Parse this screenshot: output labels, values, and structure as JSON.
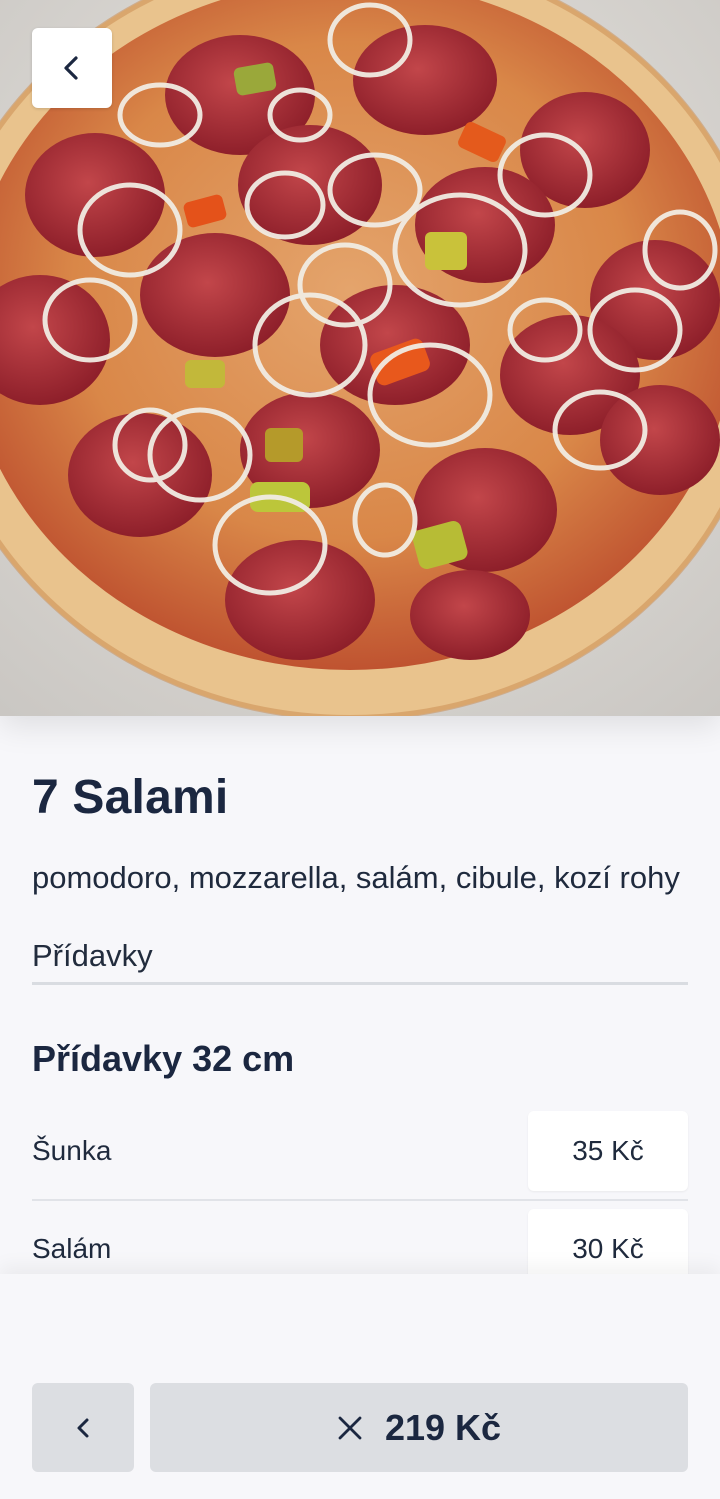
{
  "product": {
    "image_alt": "Salami pizza",
    "title": "7 Salami",
    "description": "pomodoro, mozzarella, salám, cibule, kozí rohy"
  },
  "tabs": {
    "active_label": "Přídavky"
  },
  "addons": {
    "section_title": "Přídavky 32 cm",
    "items": [
      {
        "name": "Šunka",
        "price": "35 Kč"
      },
      {
        "name": "Salám",
        "price": "30 Kč"
      }
    ]
  },
  "footer": {
    "total_price": "219 Kč"
  },
  "icons": {
    "back": "chevron-left-icon",
    "prev": "chevron-left-icon",
    "close": "close-icon"
  },
  "colors": {
    "text_primary": "#1b2740",
    "background": "#f7f7fa",
    "button_grey": "#dcdee2"
  }
}
